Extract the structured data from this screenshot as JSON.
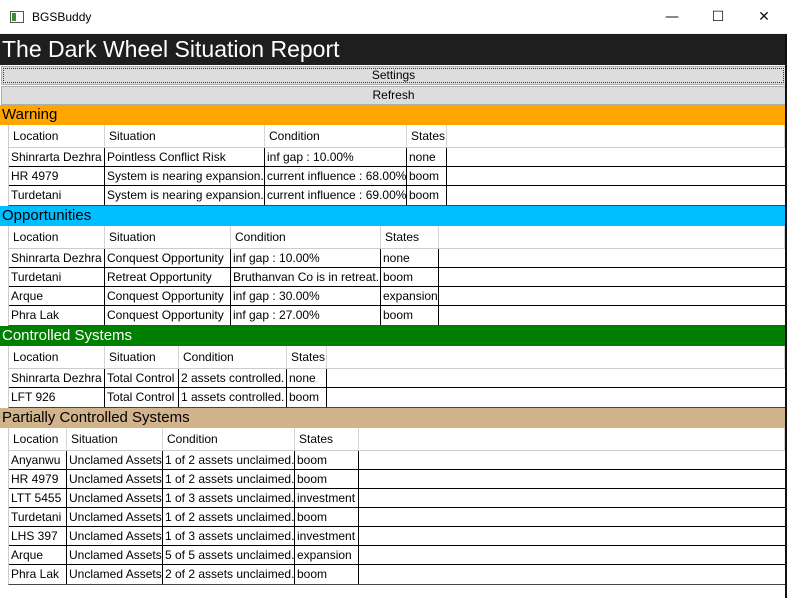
{
  "window": {
    "title": "BGSBuddy",
    "minimize_glyph": "—",
    "maximize_glyph": "☐",
    "close_glyph": "✕",
    "icon": "app-window-icon"
  },
  "report_title": "The Dark Wheel Situation Report",
  "buttons": {
    "settings": "Settings",
    "refresh": "Refresh"
  },
  "colors": {
    "warning": "#ffa500",
    "opportunities": "#00bfff",
    "controlled": "#008000",
    "partial": "#d2b48c",
    "title_bg": "#1e1e1e"
  },
  "columns": {
    "location": "Location",
    "situation": "Situation",
    "condition": "Condition",
    "states": "States"
  },
  "warning": {
    "title": "Warning",
    "rows": [
      [
        "Shinrarta Dezhra",
        "Pointless Conflict Risk",
        "inf gap : 10.00%",
        "none"
      ],
      [
        "HR 4979",
        "System is nearing expansion.",
        "current influence : 68.00%",
        "boom"
      ],
      [
        "Turdetani",
        "System is nearing expansion.",
        "current influence : 69.00%",
        "boom"
      ]
    ]
  },
  "opportunities": {
    "title": "Opportunities",
    "rows": [
      [
        "Shinrarta Dezhra",
        "Conquest Opportunity",
        "inf gap : 10.00%",
        "none"
      ],
      [
        "Turdetani",
        "Retreat Opportunity",
        "Bruthanvan Co is in retreat.",
        "boom"
      ],
      [
        "Arque",
        "Conquest Opportunity",
        "inf gap : 30.00%",
        "expansion"
      ],
      [
        "Phra Lak",
        "Conquest Opportunity",
        "inf gap : 27.00%",
        "boom"
      ]
    ]
  },
  "controlled": {
    "title": "Controlled Systems",
    "rows": [
      [
        "Shinrarta Dezhra",
        "Total Control",
        "2 assets controlled.",
        "none"
      ],
      [
        "LFT 926",
        "Total Control",
        "1 assets controlled.",
        "boom"
      ]
    ]
  },
  "partial": {
    "title": "Partially Controlled Systems",
    "rows": [
      [
        "Anyanwu",
        "Unclamed Assets",
        "1 of 2 assets unclaimed.",
        "boom"
      ],
      [
        "HR 4979",
        "Unclamed Assets",
        "1 of 2 assets unclaimed.",
        "boom"
      ],
      [
        "LTT 5455",
        "Unclamed Assets",
        "1 of 3 assets unclaimed.",
        "investment"
      ],
      [
        "Turdetani",
        "Unclamed Assets",
        "1 of 2 assets unclaimed.",
        "boom"
      ],
      [
        "LHS 397",
        "Unclamed Assets",
        "1 of 3 assets unclaimed.",
        "investment"
      ],
      [
        "Arque",
        "Unclamed Assets",
        "5 of 5 assets unclaimed.",
        "expansion"
      ],
      [
        "Phra Lak",
        "Unclamed Assets",
        "2 of 2 assets unclaimed.",
        "boom"
      ]
    ]
  }
}
